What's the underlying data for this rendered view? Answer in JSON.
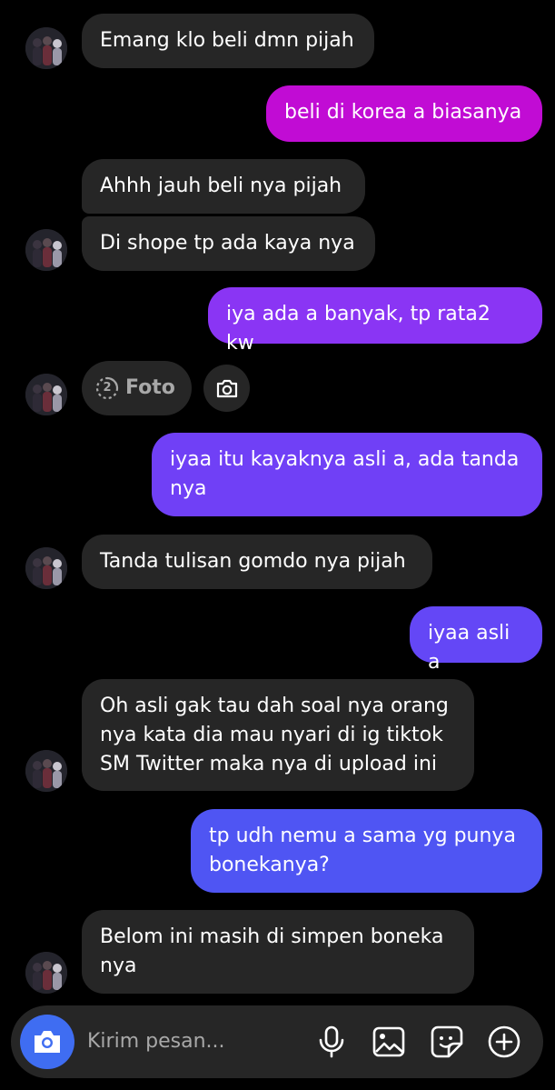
{
  "messages": [
    {
      "direction": "in",
      "text": "Emang klo beli dmn pijah"
    },
    {
      "direction": "out",
      "text": "beli di korea a biasanya"
    },
    {
      "direction": "in",
      "text": "Ahhh jauh beli nya pijah"
    },
    {
      "direction": "in",
      "text": "Di shope tp ada kaya nya"
    },
    {
      "direction": "out",
      "text": "iya ada a banyak, tp rata2 kw"
    },
    {
      "direction": "in",
      "type": "view-once-photo",
      "count": "2",
      "label": "Foto"
    },
    {
      "direction": "out",
      "text": "iyaa itu kayaknya asli a, ada tanda\nnya"
    },
    {
      "direction": "in",
      "text": "Tanda tulisan gomdo nya pijah"
    },
    {
      "direction": "out",
      "text": "iyaa asli a"
    },
    {
      "direction": "in",
      "text": "Oh asli gak tau dah soal nya orang\nnya kata dia mau nyari di ig tiktok\nSM Twitter maka nya di upload ini"
    },
    {
      "direction": "out",
      "text": "tp udh nemu a sama yg punya\nbonekanya?"
    },
    {
      "direction": "in",
      "text": "Belom ini masih di simpen boneka\nnya"
    }
  ],
  "composer": {
    "placeholder": "Kirim pesan...",
    "icons": [
      "camera-icon",
      "microphone-icon",
      "gallery-icon",
      "sticker-icon",
      "plus-icon"
    ]
  },
  "colors": {
    "background": "#000000",
    "incoming_bubble": "#262626",
    "outgoing_gradient": [
      "#c10cd4",
      "#8a35f4",
      "#5a4ff7",
      "#4559f2"
    ],
    "accent": "#3f6df2",
    "placeholder": "#a8a8a8"
  }
}
